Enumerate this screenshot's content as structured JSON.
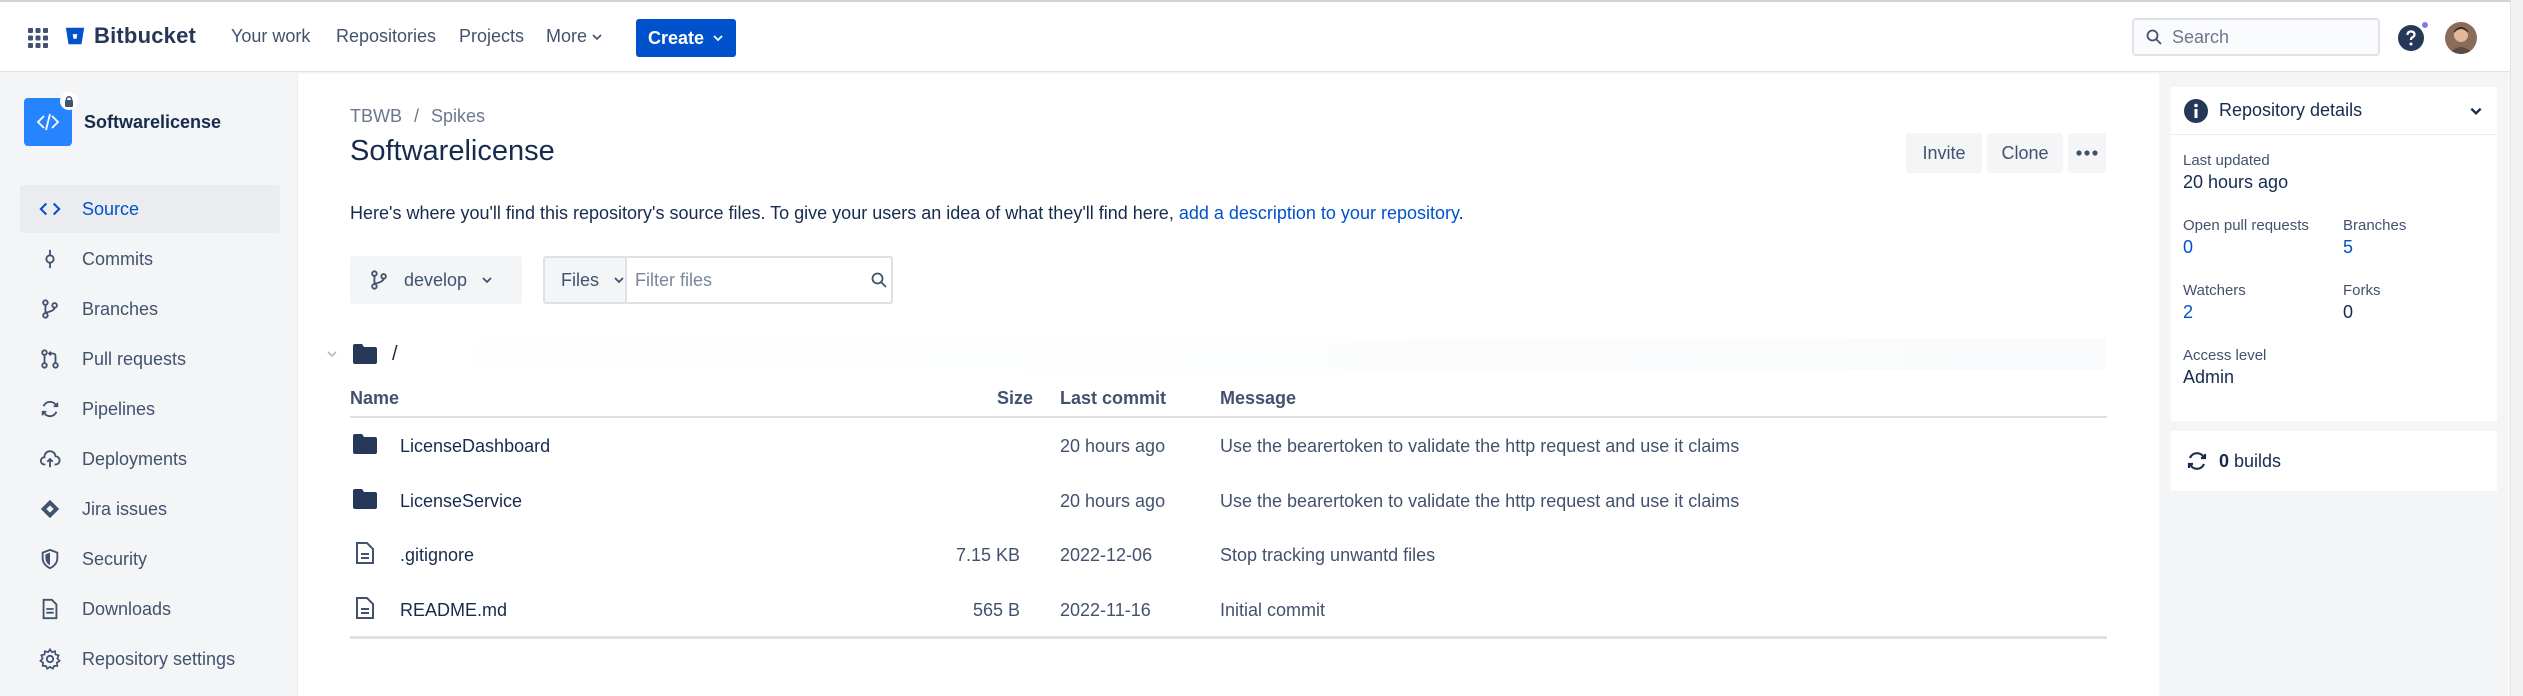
{
  "app": {
    "name": "Bitbucket"
  },
  "nav": {
    "items": [
      {
        "label": "Your work"
      },
      {
        "label": "Repositories"
      },
      {
        "label": "Projects"
      },
      {
        "label": "More"
      }
    ],
    "create_label": "Create",
    "search_placeholder": "Search"
  },
  "sidebar": {
    "repo_name": "Softwarelicense",
    "items": [
      {
        "label": "Source",
        "icon": "code-icon",
        "active": true
      },
      {
        "label": "Commits",
        "icon": "commit-icon"
      },
      {
        "label": "Branches",
        "icon": "branch-icon"
      },
      {
        "label": "Pull requests",
        "icon": "pull-request-icon"
      },
      {
        "label": "Pipelines",
        "icon": "pipelines-icon"
      },
      {
        "label": "Deployments",
        "icon": "cloud-upload-icon"
      },
      {
        "label": "Jira issues",
        "icon": "jira-icon"
      },
      {
        "label": "Security",
        "icon": "shield-icon"
      },
      {
        "label": "Downloads",
        "icon": "download-icon"
      },
      {
        "label": "Repository settings",
        "icon": "gear-icon"
      }
    ]
  },
  "breadcrumb": {
    "workspace": "TBWB",
    "separator": "/",
    "project": "Spikes"
  },
  "page": {
    "title": "Softwarelicense",
    "invite_label": "Invite",
    "clone_label": "Clone",
    "intro_text": "Here's where you'll find this repository's source files. To give your users an idea of what they'll find here, ",
    "intro_link": "add a description to your repository",
    "intro_end": "."
  },
  "toolbar": {
    "branch": "develop",
    "files_label": "Files",
    "filter_placeholder": "Filter files"
  },
  "path": "/",
  "table": {
    "headers": {
      "name": "Name",
      "size": "Size",
      "last_commit": "Last commit",
      "message": "Message"
    },
    "rows": [
      {
        "type": "folder",
        "name": "LicenseDashboard",
        "size": "",
        "date": "20 hours ago",
        "message": "Use the bearertoken to validate the http request and use it claims"
      },
      {
        "type": "folder",
        "name": "LicenseService",
        "size": "",
        "date": "20 hours ago",
        "message": "Use the bearertoken to validate the http request and use it claims"
      },
      {
        "type": "file",
        "name": ".gitignore",
        "size": "7.15 KB",
        "date": "2022-12-06",
        "message": "Stop tracking unwantd files"
      },
      {
        "type": "file",
        "name": "README.md",
        "size": "565 B",
        "date": "2022-11-16",
        "message": "Initial commit"
      }
    ]
  },
  "details": {
    "title": "Repository details",
    "last_updated_label": "Last updated",
    "last_updated": "20 hours ago",
    "open_prs_label": "Open pull requests",
    "open_prs": "0",
    "branches_label": "Branches",
    "branches": "5",
    "watchers_label": "Watchers",
    "watchers": "2",
    "forks_label": "Forks",
    "forks": "0",
    "access_label": "Access level",
    "access": "Admin",
    "builds_count": "0",
    "builds_label": "builds"
  },
  "colors": {
    "primary": "#0052cc",
    "text": "#172b4d",
    "subtle": "#42526e",
    "sidebar_bg": "#f4f5f7",
    "repo_avatar": "#2684ff"
  }
}
